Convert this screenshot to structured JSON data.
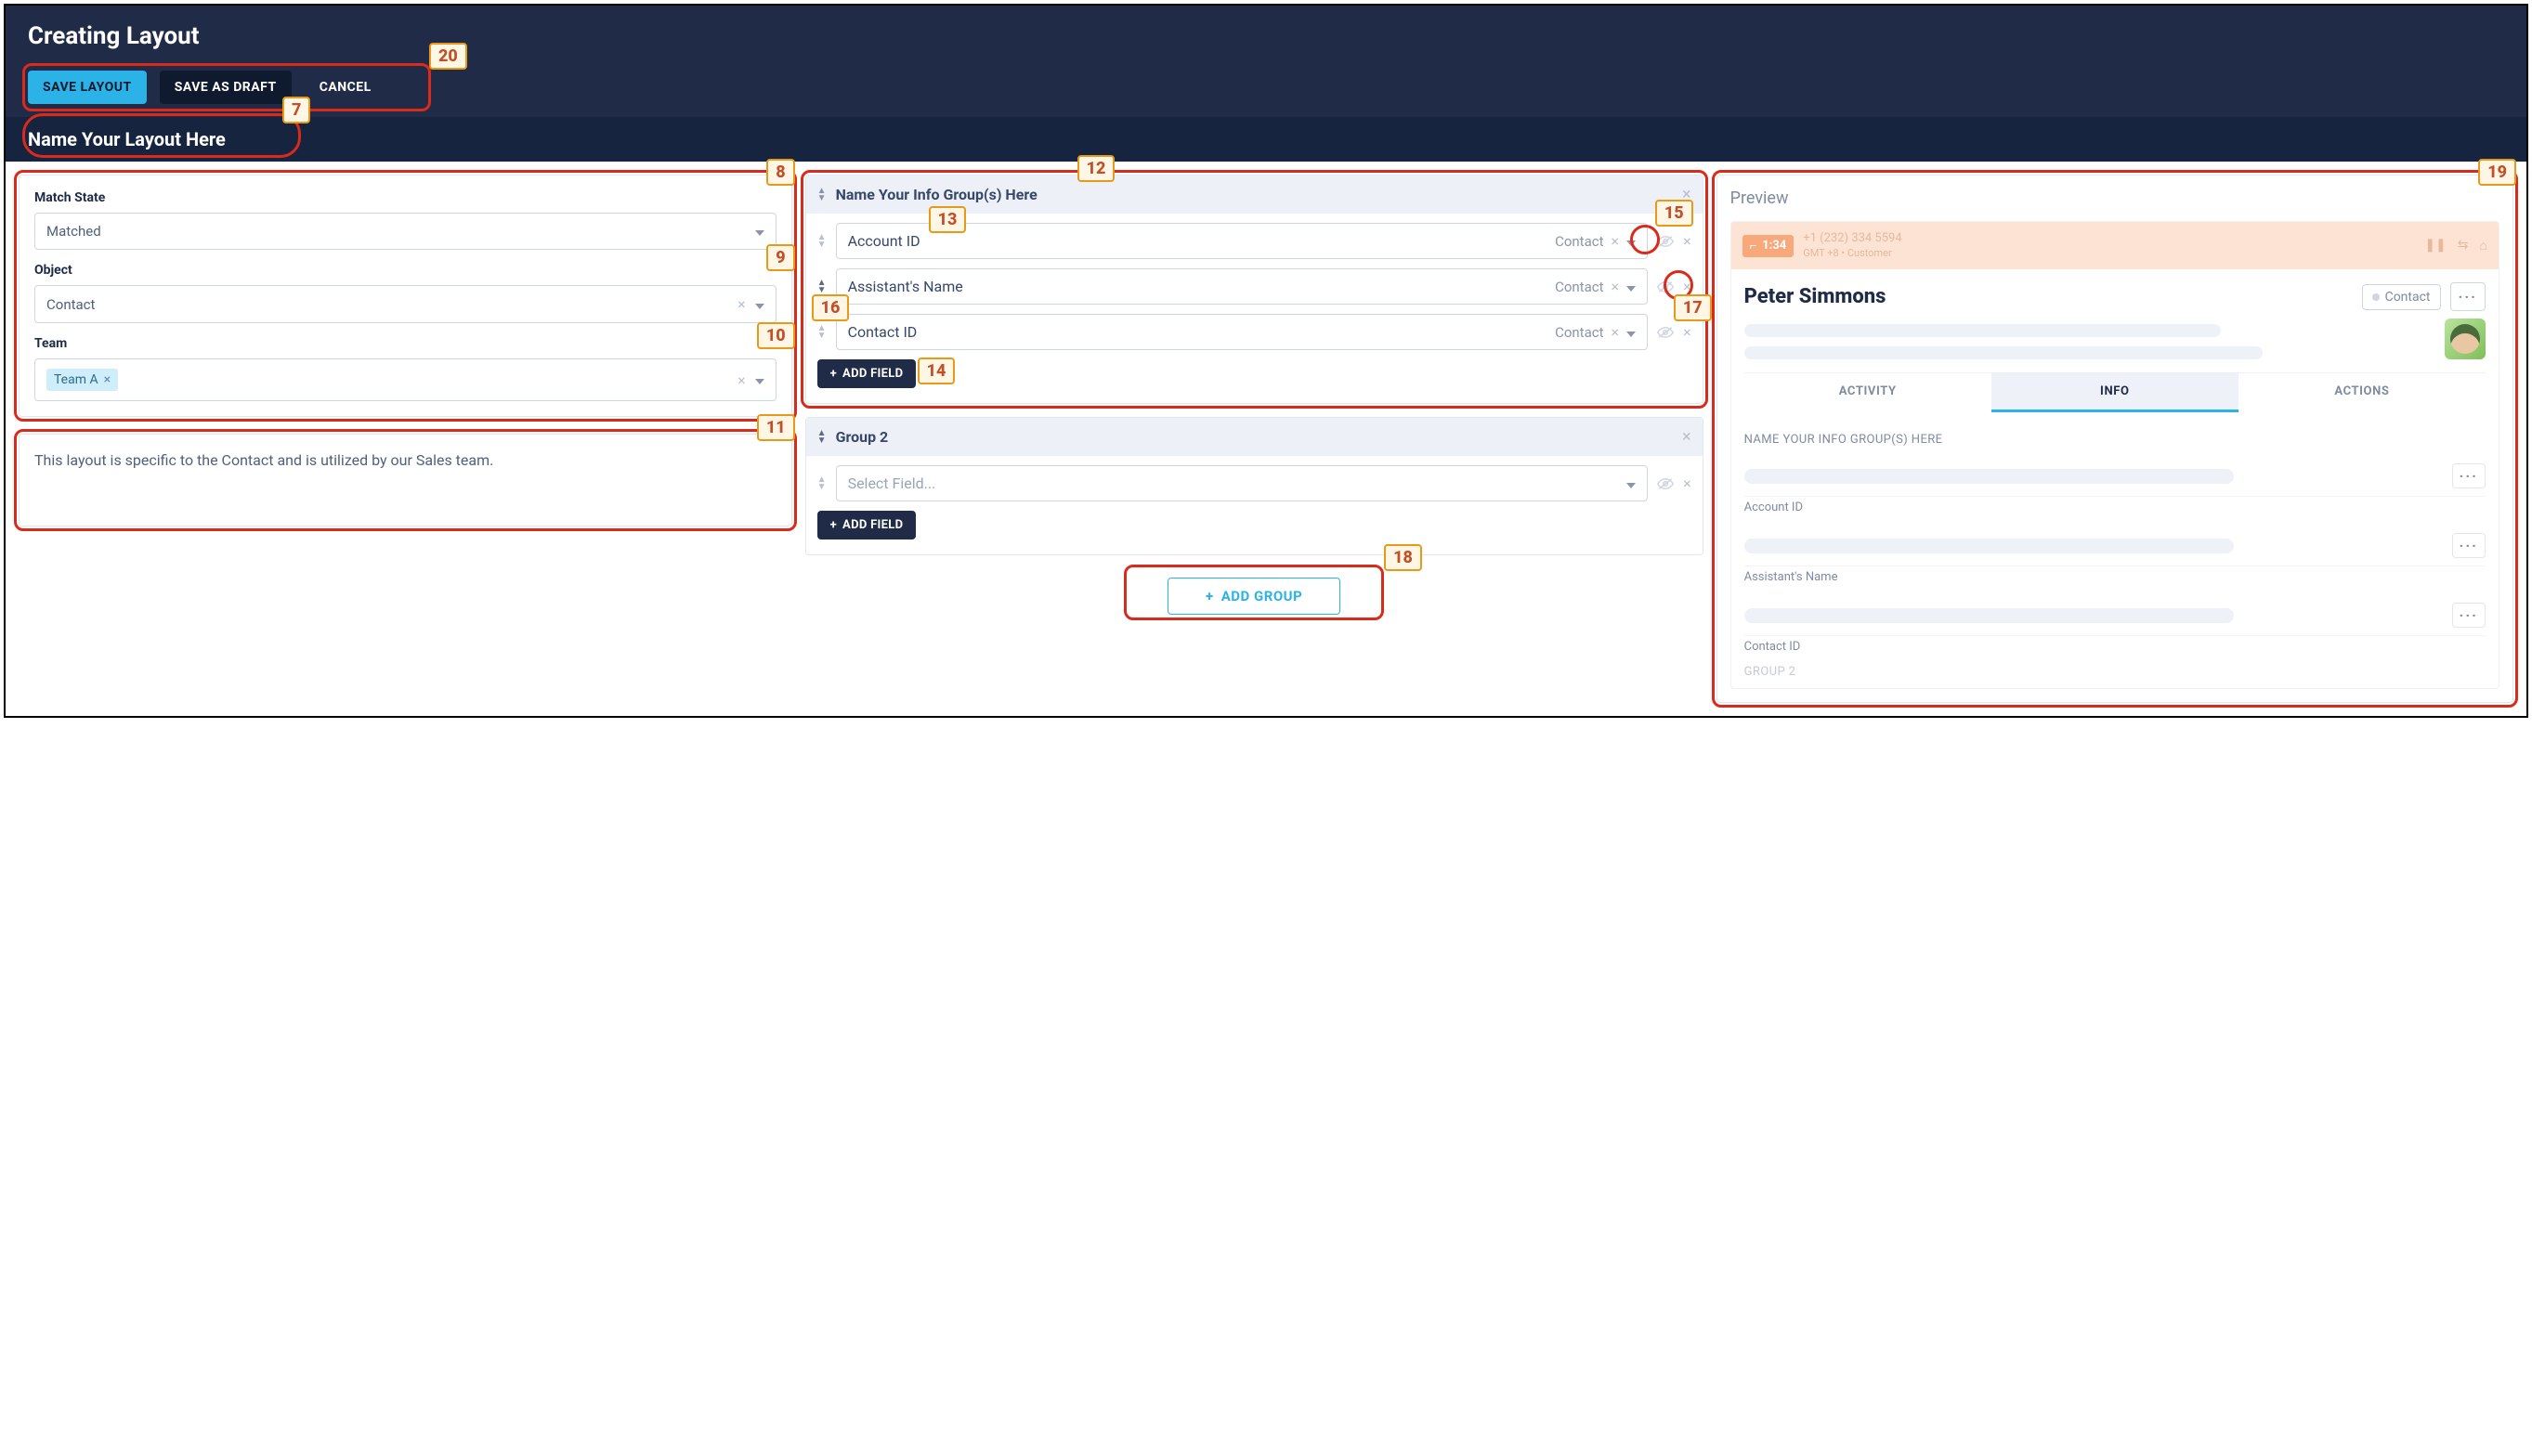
{
  "page_title": "Creating Layout",
  "toolbar": {
    "save": "SAVE LAYOUT",
    "draft": "SAVE AS DRAFT",
    "cancel": "CANCEL"
  },
  "layout_name_placeholder": "Name Your Layout Here",
  "left": {
    "match_state_label": "Match State",
    "match_state_value": "Matched",
    "object_label": "Object",
    "object_value": "Contact",
    "team_label": "Team",
    "team_tag": "Team A",
    "description": "This layout is specific to the Contact and is utilized by our Sales team."
  },
  "groups": [
    {
      "title": "Name Your Info Group(s) Here",
      "fields": [
        {
          "name": "Account ID",
          "source": "Contact"
        },
        {
          "name": "Assistant's Name",
          "source": "Contact"
        },
        {
          "name": "Contact ID",
          "source": "Contact"
        }
      ],
      "add_field": "ADD FIELD"
    },
    {
      "title": "Group 2",
      "fields": [
        {
          "name": "Select Field...",
          "source": ""
        }
      ],
      "add_field": "ADD FIELD"
    }
  ],
  "add_group": "ADD GROUP",
  "preview": {
    "title": "Preview",
    "call_duration": "1:34",
    "phone": "+1 (232) 334 5594",
    "sub": "GMT +8 • Customer",
    "name": "Peter Simmons",
    "pill": "Contact",
    "tabs": {
      "activity": "ACTIVITY",
      "info": "INFO",
      "actions": "ACTIONS"
    },
    "section_title": "NAME YOUR INFO GROUP(S) HERE",
    "items": [
      "Account ID",
      "Assistant's Name",
      "Contact ID"
    ],
    "group2": "GROUP 2"
  },
  "annotations": {
    "7": "7",
    "8": "8",
    "9": "9",
    "10": "10",
    "11": "11",
    "12": "12",
    "13": "13",
    "14": "14",
    "15": "15",
    "16": "16",
    "17": "17",
    "18": "18",
    "19": "19",
    "20": "20"
  }
}
